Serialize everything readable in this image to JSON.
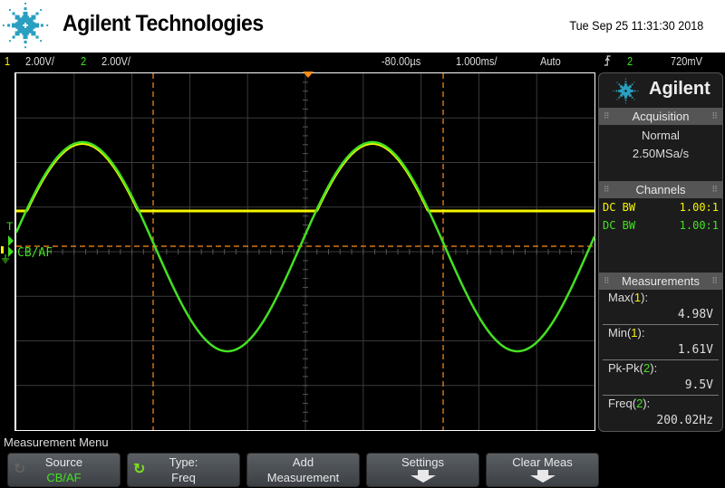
{
  "header": {
    "brand": "Agilent Technologies",
    "datetime": "Tue Sep 25 11:31:30 2018"
  },
  "statusbar": {
    "ch1_num": "1",
    "ch1_scale": "2.00V/",
    "ch2_num": "2",
    "ch2_scale": "2.00V/",
    "time_offset": "-80.00µs",
    "time_scale": "1.000ms/",
    "trigger_mode": "Auto",
    "trigger_slope_icon": "rising-edge-icon",
    "trigger_source": "2",
    "trigger_level": "720mV"
  },
  "screen": {
    "trigger_marker_label": "T",
    "source_label": "CB/AF",
    "colors": {
      "ch1": "#f5f500",
      "ch2": "#44e022",
      "cursor": "#ff8c1a",
      "grid": "#3a3a3a"
    },
    "waveforms": {
      "ch1": {
        "description": "clipped sine (half-rectified), volts",
        "min_v": 1.61,
        "max_v": 4.98
      },
      "ch2": {
        "description": "sine",
        "pk_pk_v": 9.5,
        "freq_hz": 200.02
      }
    }
  },
  "side_panel": {
    "brand": "Agilent",
    "acquisition": {
      "title": "Acquisition",
      "mode": "Normal",
      "rate": "2.50MSa/s"
    },
    "channels": {
      "title": "Channels",
      "rows": [
        {
          "coupling": "DC BW",
          "probe": "1.00:1",
          "color": "#f5f500"
        },
        {
          "coupling": "DC BW",
          "probe": "1.00:1",
          "color": "#44e022"
        }
      ]
    },
    "measurements": {
      "title": "Measurements",
      "items": [
        {
          "name": "Max(",
          "ch": "1",
          "close": "):",
          "value": "4.98V",
          "ch_color": "#f5f500"
        },
        {
          "name": "Min(",
          "ch": "1",
          "close": "):",
          "value": "1.61V",
          "ch_color": "#f5f500"
        },
        {
          "name": "Pk-Pk(",
          "ch": "2",
          "close": "):",
          "value": "9.5V",
          "ch_color": "#44e022"
        },
        {
          "name": "Freq(",
          "ch": "2",
          "close": "):",
          "value": "200.02Hz",
          "ch_color": "#44e022"
        }
      ]
    }
  },
  "menu": {
    "title": "Measurement Menu",
    "softkeys": [
      {
        "line1": "Source",
        "line2": "CB/AF"
      },
      {
        "line1": "Type:",
        "line2": "Freq"
      },
      {
        "line1": "Add",
        "line2": "Measurement"
      },
      {
        "line1": "Settings",
        "line2": ""
      },
      {
        "line1": "Clear Meas",
        "line2": ""
      }
    ]
  }
}
